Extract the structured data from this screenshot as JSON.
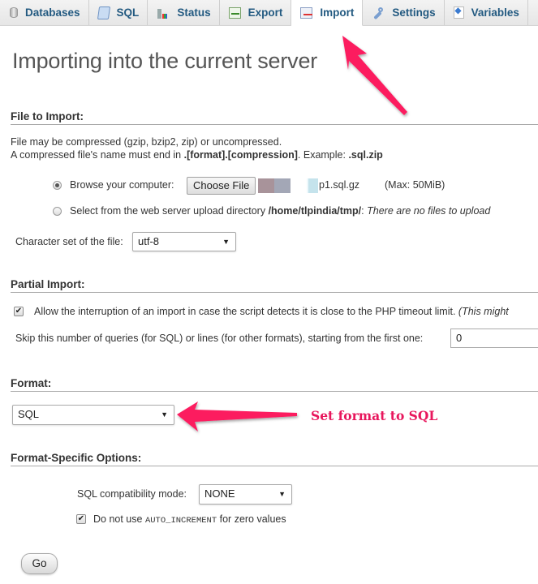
{
  "tabs": [
    {
      "label": "Databases",
      "icon": "database-icon",
      "active": false
    },
    {
      "label": "SQL",
      "icon": "sql-scroll-icon",
      "active": false
    },
    {
      "label": "Status",
      "icon": "status-chart-icon",
      "active": false
    },
    {
      "label": "Export",
      "icon": "export-icon",
      "active": false
    },
    {
      "label": "Import",
      "icon": "import-icon",
      "active": true
    },
    {
      "label": "Settings",
      "icon": "wrench-icon",
      "active": false
    },
    {
      "label": "Variables",
      "icon": "variables-icon",
      "active": false
    }
  ],
  "page_title": "Importing into the current server",
  "file_to_import": {
    "title": "File to Import:",
    "line1": "File may be compressed (gzip, bzip2, zip) or uncompressed.",
    "line2_prefix": "A compressed file's name must end in ",
    "line2_bold": ".[format].[compression]",
    "line2_mid": ". Example: ",
    "line2_example": ".sql.zip",
    "browse_label": "Browse your computer:",
    "choose_file_label": "Choose File",
    "chosen_file_suffix": "p1.sql.gz",
    "max_size": "(Max: 50MiB)",
    "server_dir_label": "Select from the web server upload directory ",
    "server_dir_path": "/home/tlpindia/tmp/",
    "server_dir_colon": ":",
    "server_dir_note": "There are no files to upload",
    "browse_selected": true,
    "charset_label": "Character set of the file:",
    "charset_value": "utf-8"
  },
  "partial_import": {
    "title": "Partial Import:",
    "allow_interrupt_label": "Allow the interruption of an import in case the script detects it is close to the PHP timeout limit. ",
    "allow_interrupt_note": "(This might",
    "allow_interrupt_checked": true,
    "skip_label": "Skip this number of queries (for SQL) or lines (for other formats), starting from the first one:",
    "skip_value": "0"
  },
  "format": {
    "title": "Format:",
    "value": "SQL"
  },
  "format_specific": {
    "title": "Format-Specific Options:",
    "compat_label": "SQL compatibility mode:",
    "compat_value": "NONE",
    "auto_inc_prefix": "Do not use ",
    "auto_inc_code": "AUTO_INCREMENT",
    "auto_inc_suffix": " for zero values",
    "auto_inc_checked": true
  },
  "go_label": "Go",
  "annotation": {
    "text": "Set format to SQL",
    "color": "#e8175d"
  },
  "checkmark": "✔",
  "caret": "▼"
}
